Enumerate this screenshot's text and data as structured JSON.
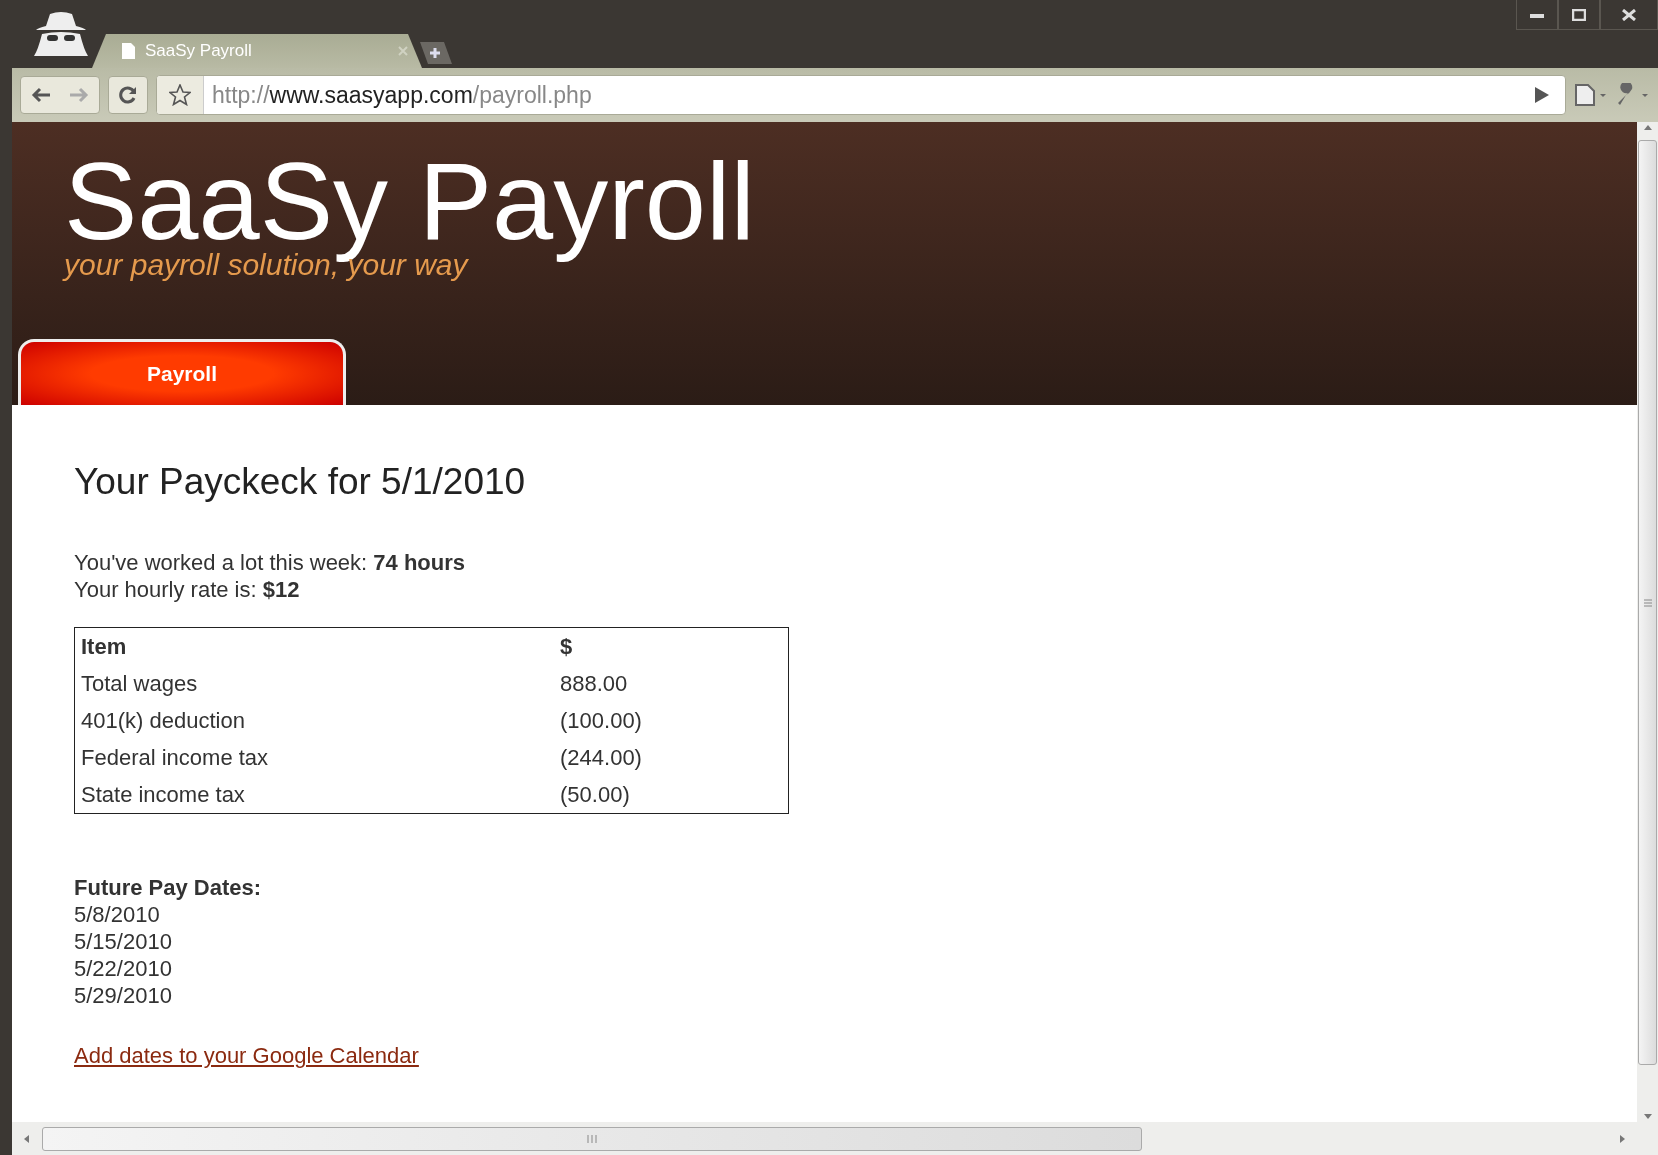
{
  "browser": {
    "tab": {
      "title": "SaaSy Payroll",
      "selected": true
    },
    "url": {
      "scheme": "http://",
      "host": "www.saasyapp.com",
      "path": "/payroll.php"
    }
  },
  "header": {
    "title": "SaaSy Payroll",
    "tagline": "your payroll solution, your way",
    "nav": [
      {
        "label": "Payroll",
        "selected": true
      }
    ]
  },
  "content": {
    "heading": "Your Payckeck for 5/1/2010",
    "lines": [
      "You've worked a lot this week: **74 hours**",
      "Your hourly rate is: **$12**"
    ],
    "table": {
      "columns": [
        "Item",
        "$"
      ],
      "rows": [
        [
          "Total wages",
          "888.00"
        ],
        [
          "401(k) deduction",
          "(100.00)"
        ],
        [
          "Federal income tax",
          "(244.00)"
        ],
        [
          "State income tax",
          "(50.00)"
        ]
      ]
    },
    "future_heading": "Future Pay Dates:",
    "dates": [
      "5/8/2010",
      "5/15/2010",
      "5/22/2010",
      "5/29/2010"
    ],
    "link": "Add dates to your Google Calendar"
  }
}
